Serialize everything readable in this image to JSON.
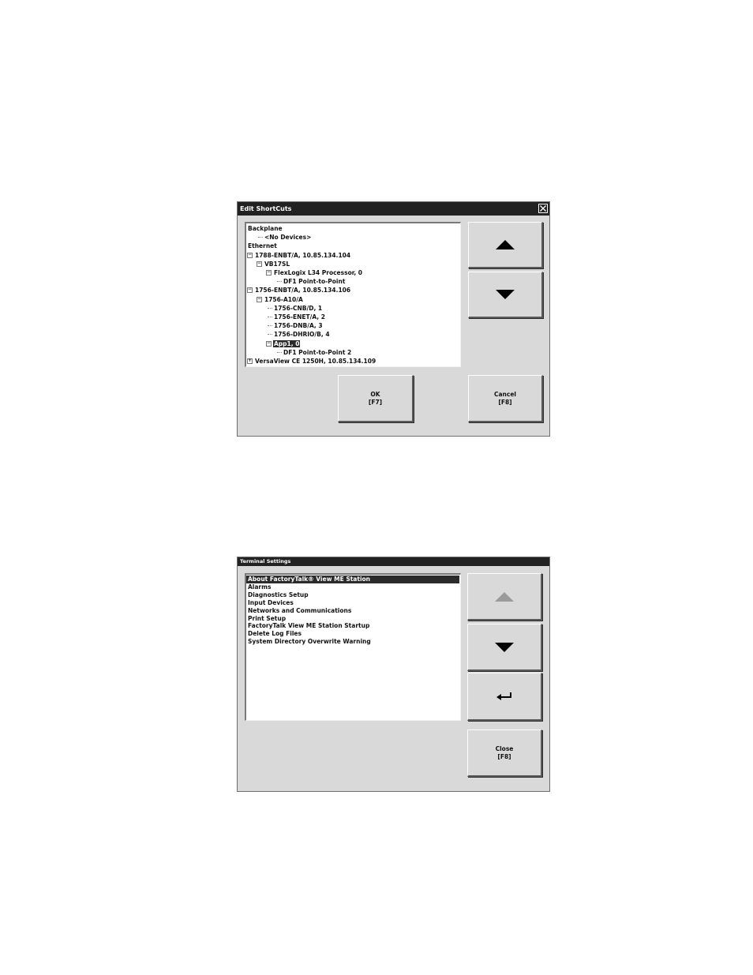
{
  "edit_shortcuts": {
    "title": "Edit ShortCuts",
    "tree": [
      {
        "label": "Backplane",
        "level": 0,
        "expander": ""
      },
      {
        "label": "<No Devices>",
        "level": 1,
        "expander": ""
      },
      {
        "label": "Ethernet",
        "level": 0,
        "expander": ""
      },
      {
        "label": "1788-ENBT/A, 10.85.134.104",
        "level": 0,
        "expander": "−"
      },
      {
        "label": "VB17SL",
        "level": 1,
        "expander": "−"
      },
      {
        "label": "FlexLogix L34 Processor, 0",
        "level": 2,
        "expander": "−"
      },
      {
        "label": "DF1 Point-to-Point",
        "level": 3,
        "expander": ""
      },
      {
        "label": "1756-ENBT/A, 10.85.134.106",
        "level": 0,
        "expander": "−"
      },
      {
        "label": "1756-A10/A",
        "level": 1,
        "expander": "−"
      },
      {
        "label": "1756-CNB/D, 1",
        "level": 2,
        "expander": ""
      },
      {
        "label": "1756-ENET/A, 2",
        "level": 2,
        "expander": ""
      },
      {
        "label": "1756-DNB/A, 3",
        "level": 2,
        "expander": ""
      },
      {
        "label": "1756-DHRIO/B, 4",
        "level": 2,
        "expander": ""
      },
      {
        "label": "App1, 0",
        "level": 2,
        "expander": "−",
        "selected": true
      },
      {
        "label": "DF1 Point-to-Point 2",
        "level": 3,
        "expander": ""
      },
      {
        "label": "VersaView CE 1250H, 10.85.134.109",
        "level": 0,
        "expander": "+"
      }
    ],
    "ok_label": "OK",
    "ok_key": "[F7]",
    "cancel_label": "Cancel",
    "cancel_key": "[F8]",
    "icons": {
      "up": "arrow-up-icon",
      "down": "arrow-down-icon",
      "close": "close-icon"
    }
  },
  "terminal_settings": {
    "title": "Terminal Settings",
    "items": [
      {
        "label": "About FactoryTalk® View ME Station",
        "selected": true
      },
      {
        "label": "Alarms"
      },
      {
        "label": "Diagnostics Setup"
      },
      {
        "label": "Input Devices"
      },
      {
        "label": "Networks and Communications"
      },
      {
        "label": "Print Setup"
      },
      {
        "label": "FactoryTalk View ME Station Startup"
      },
      {
        "label": "Delete Log Files"
      },
      {
        "label": "System Directory Overwrite Warning"
      }
    ],
    "close_label": "Close",
    "close_key": "[F8]",
    "icons": {
      "up": "arrow-up-icon",
      "down": "arrow-down-icon",
      "enter": "enter-icon"
    },
    "up_disabled": true
  }
}
